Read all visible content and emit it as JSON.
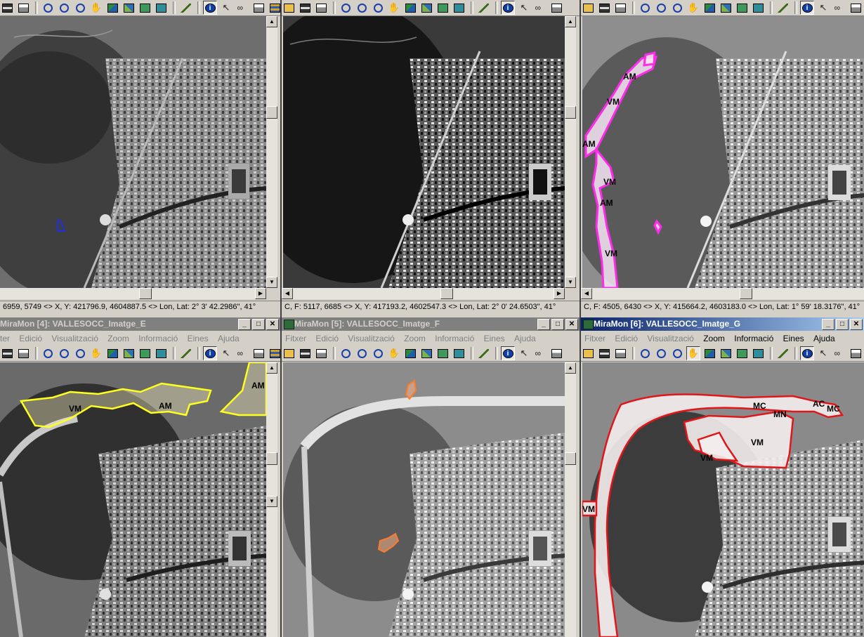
{
  "top_row": [
    {
      "coords": "6959, 5749 <> X, Y: 421796.9, 4604887.5 <> Lon, Lat: 2° 3' 42.2986\", 41°"
    },
    {
      "coords": "C, F: 5117, 6685 <> X, Y: 417193.2, 4602547.3 <> Lon, Lat: 2° 0' 24.6503\", 41°"
    },
    {
      "coords": "C, F: 4505, 6430 <> X, Y: 415664.2, 4603183.0 <> Lon, Lat: 1° 59' 18.3176\", 41°"
    }
  ],
  "bottom_row": [
    {
      "title": "MiraMon [4]: VALLESOCC_Imatge_E",
      "menu": [
        "ter",
        "Edició",
        "Visualització",
        "Zoom",
        "Informació",
        "Eines",
        "Ajuda"
      ],
      "enabled_menu": [],
      "map_labels": [
        "VM",
        "AM",
        "AM"
      ],
      "outline_color": "#ffff1e"
    },
    {
      "title": "MiraMon [5]: VALLESOCC_Imatge_F",
      "menu": [
        "Fitxer",
        "Edició",
        "Visualització",
        "Zoom",
        "Informació",
        "Eines",
        "Ajuda"
      ],
      "enabled_menu": [],
      "map_labels": [],
      "outline_color": "#ff7a2a"
    },
    {
      "title": "MiraMon [6]: VALLESOCC_Imatge_G",
      "menu": [
        "Fitxer",
        "Edició",
        "Visualització",
        "Zoom",
        "Informació",
        "Eines",
        "Ajuda"
      ],
      "enabled_menu": [
        "Zoom",
        "Informació",
        "Eines",
        "Ajuda"
      ],
      "map_labels": [
        "MC",
        "AC",
        "MC",
        "MN",
        "VM",
        "VM",
        "VM"
      ],
      "outline_color": "#e0161a"
    }
  ],
  "top_map_labels": {
    "window_3": [
      "AM",
      "VM",
      "AM",
      "VM",
      "AM",
      "VM"
    ]
  },
  "window_buttons": {
    "minimize": "_",
    "maximize": "□",
    "close": "✕"
  },
  "toolbar_icons": [
    "save-icon",
    "print-icon",
    "zoom-in-icon",
    "zoom-out-icon",
    "zoom-window-icon",
    "pan-hand-icon",
    "view-image-icon",
    "view-image-2-icon",
    "view-image-3-icon",
    "globe-search-icon",
    "brush-icon",
    "info-icon",
    "pointer-icon",
    "binoculars-icon",
    "measure-icon",
    "layers-icon"
  ],
  "colors": {
    "title_active": "#0a246a",
    "title_inactive": "#808080",
    "outline_blue": "#1f2fe0",
    "outline_magenta": "#ff2bea"
  }
}
